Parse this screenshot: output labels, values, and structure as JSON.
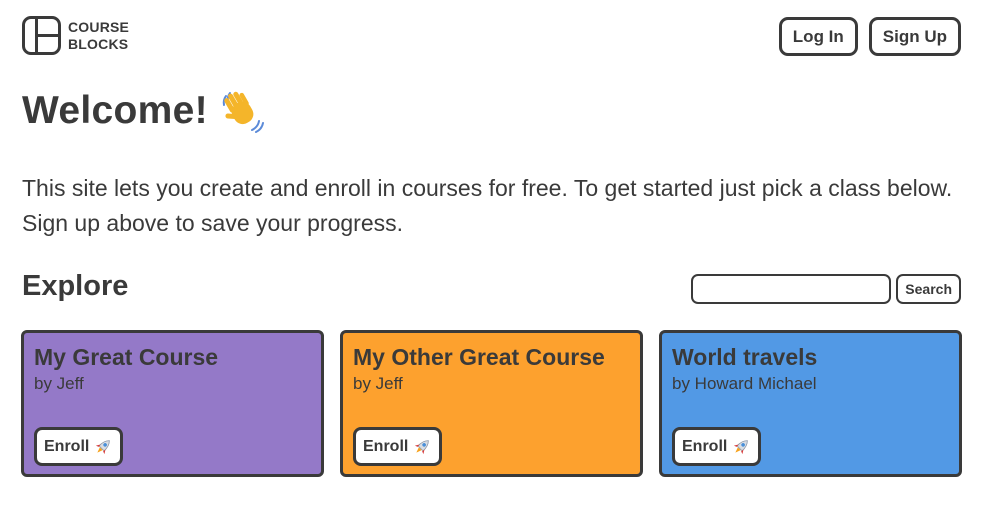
{
  "brand": {
    "line1": "COURSE",
    "line2": "BLOCKS"
  },
  "auth": {
    "login_label": "Log In",
    "signup_label": "Sign Up"
  },
  "welcome": {
    "title": "Welcome!",
    "icon": "waving-hand-icon"
  },
  "intro": {
    "text": "This site lets you create and enroll in courses for free. To get started just pick a class below. Sign up above to save your progress."
  },
  "explore": {
    "title": "Explore",
    "search": {
      "value": "",
      "placeholder": "",
      "button_label": "Search"
    }
  },
  "courses": [
    {
      "title": "My Great Course",
      "author": "by Jeff",
      "color": "#9479c8",
      "enroll_label": "Enroll",
      "icon": "rocket-icon"
    },
    {
      "title": "My Other Great Course",
      "author": "by Jeff",
      "color": "#fda12e",
      "enroll_label": "Enroll",
      "icon": "rocket-icon"
    },
    {
      "title": "World travels",
      "author": "by Howard Michael",
      "color": "#5299e5",
      "enroll_label": "Enroll",
      "icon": "rocket-icon"
    }
  ],
  "colors": {
    "text": "#3a3a3a",
    "background": "#ffffff"
  }
}
